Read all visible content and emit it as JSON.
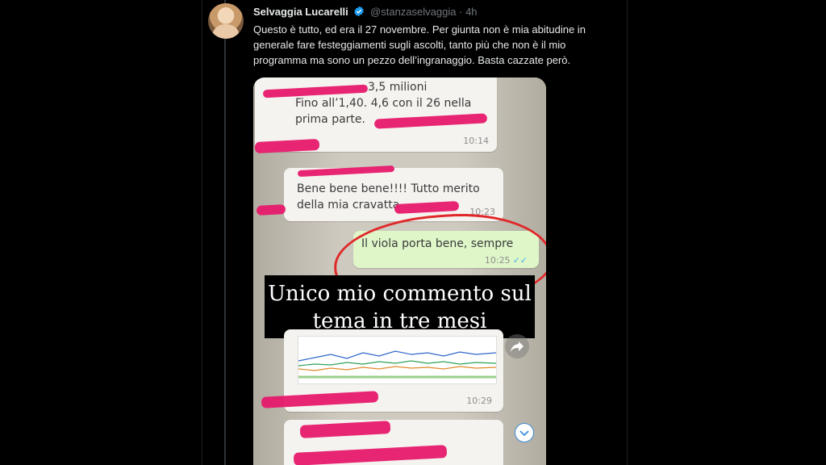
{
  "tweet": {
    "author_name": "Selvaggia Lucarelli",
    "handle": "@stanzaselvaggia",
    "separator": "·",
    "time": "4h",
    "text": "Questo è tutto, ed era il 27 novembre. Per giunta non è mia abitudine in generale fare festeggiamenti sugli ascolti, tanto più che non è il mio programma ma sono un pezzo dell’ingranaggio. Basta cazzate però."
  },
  "media": {
    "messages": [
      {
        "text_line1": "3,5 milioni",
        "text_line2": "Fino all’1,40. 4,6 con il 26 nella",
        "text_line3": "prima parte.",
        "time": "10:14"
      },
      {
        "text_line1": "Bene bene bene!!!! Tutto merito",
        "text_line2": "della mia cravatta",
        "time": "10:23"
      },
      {
        "text": "Il viola porta bene, sempre",
        "time": "10:25"
      },
      {
        "time": "10:29"
      }
    ],
    "caption_line1": "Unico mio commento sul",
    "caption_line2": "tema in tre mesi",
    "colors": {
      "scribble": "#e6196b",
      "circle": "#e0282a",
      "sent_bubble": "#dff6c9"
    }
  },
  "icons": [
    "verified-badge-icon",
    "share-icon",
    "scroll-down-icon"
  ]
}
